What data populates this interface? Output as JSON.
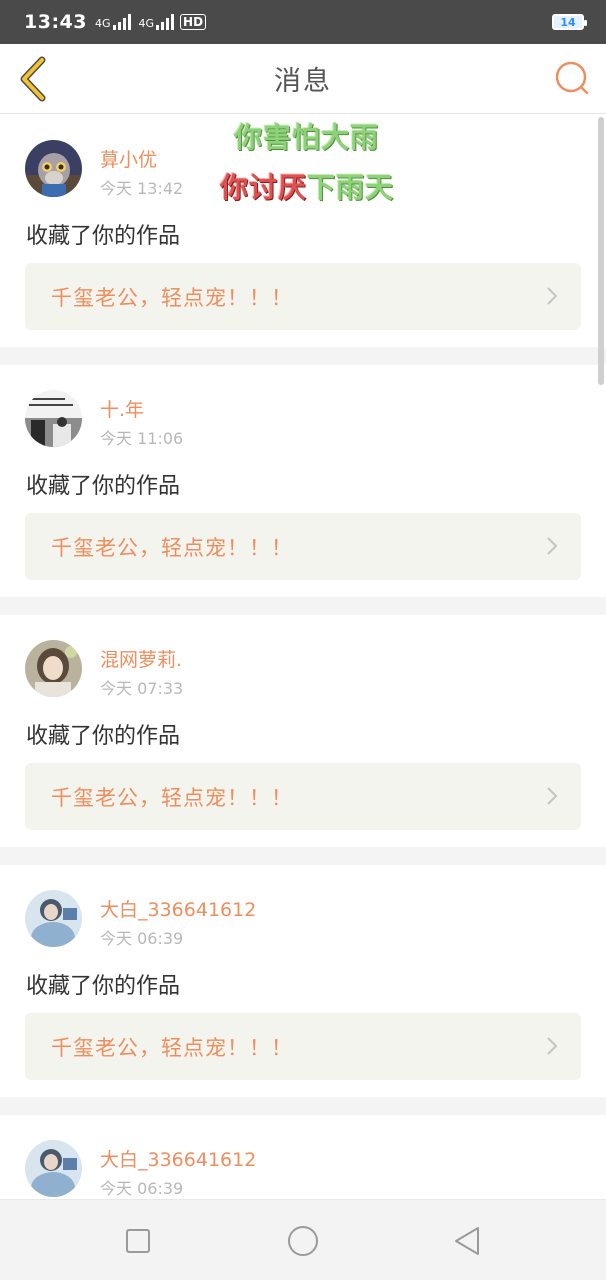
{
  "status_bar": {
    "time": "13:43",
    "network1": "4G",
    "network2": "4G",
    "hd": "HD",
    "battery": "14"
  },
  "navbar": {
    "title": "消息",
    "back_icon": "chevron-left-icon",
    "search_icon": "search-icon"
  },
  "overlay": {
    "line1": "你害怕大雨",
    "line2_part1": "你讨厌",
    "line2_part2": "下雨天"
  },
  "messages": [
    {
      "name": "萛小优",
      "time": "今天 13:42",
      "action": "收藏了你的作品",
      "work_title": "千玺老公，轻点宠！！！",
      "avatar_icon": "cartoon-fox-avatar"
    },
    {
      "name": "十.年",
      "time": "今天 11:06",
      "action": "收藏了你的作品",
      "work_title": "千玺老公，轻点宠！！！",
      "avatar_icon": "photo-avatar"
    },
    {
      "name": "混网萝莉.",
      "time": "今天 07:33",
      "action": "收藏了你的作品",
      "work_title": "千玺老公，轻点宠！！！",
      "avatar_icon": "girl-avatar"
    },
    {
      "name": "大白_336641612",
      "time": "今天 06:39",
      "action": "收藏了你的作品",
      "work_title": "千玺老公，轻点宠！！！",
      "avatar_icon": "person-blue-avatar"
    },
    {
      "name": "大白_336641612",
      "time": "今天 06:39",
      "action": "",
      "work_title": "",
      "avatar_icon": "person-blue-avatar"
    }
  ],
  "colors": {
    "accent": "#ee8e5e",
    "card_bg": "#f4f4ee",
    "separator": "#f4f4f4",
    "back_icon": "#f2c230"
  },
  "system_nav": {
    "recent_icon": "square-icon",
    "home_icon": "circle-icon",
    "back_icon": "triangle-back-icon"
  }
}
